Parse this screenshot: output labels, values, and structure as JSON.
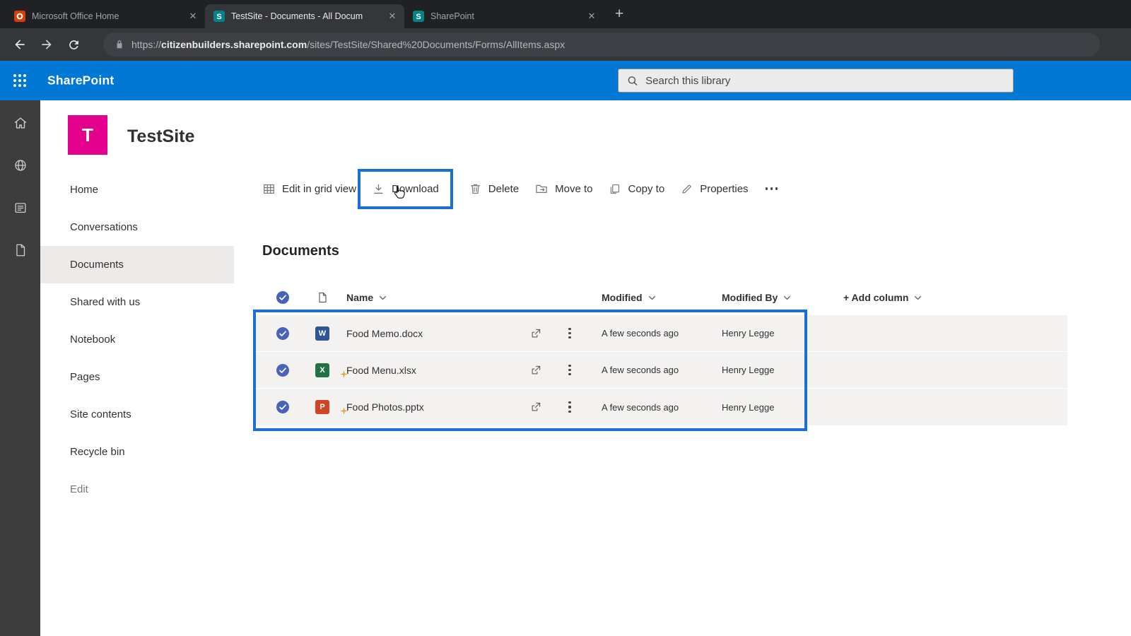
{
  "browser": {
    "tabs": [
      {
        "title": "Microsoft Office Home"
      },
      {
        "title": "TestSite - Documents - All Docum"
      },
      {
        "title": "SharePoint"
      }
    ],
    "close_glyph": "✕",
    "new_tab_glyph": "+",
    "url": {
      "scheme": "https://",
      "domain": "citizenbuilders.sharepoint.com",
      "path": "/sites/TestSite/Shared%20Documents/Forms/AllItems.aspx"
    }
  },
  "suite_bar": {
    "brand": "SharePoint",
    "search_placeholder": "Search this library"
  },
  "site": {
    "logo_letter": "T",
    "name": "TestSite"
  },
  "app_rail": {
    "icons": [
      "home-icon",
      "globe-icon",
      "news-icon",
      "document-icon"
    ]
  },
  "sidebar": {
    "items": [
      {
        "label": "Home"
      },
      {
        "label": "Conversations"
      },
      {
        "label": "Documents",
        "selected": true
      },
      {
        "label": "Shared with us"
      },
      {
        "label": "Notebook"
      },
      {
        "label": "Pages"
      },
      {
        "label": "Site contents"
      },
      {
        "label": "Recycle bin"
      },
      {
        "label": "Edit",
        "muted": true
      }
    ]
  },
  "command_bar": {
    "items": [
      {
        "label": "Edit in grid view",
        "icon": "grid-view-icon"
      },
      {
        "label": "Download",
        "icon": "download-icon",
        "highlighted": true
      },
      {
        "label": "Delete",
        "icon": "trash-icon"
      },
      {
        "label": "Move to",
        "icon": "move-to-icon"
      },
      {
        "label": "Copy to",
        "icon": "copy-to-icon"
      },
      {
        "label": "Properties",
        "icon": "pencil-icon"
      }
    ],
    "overflow_icon": "more-options-icon"
  },
  "library": {
    "title": "Documents",
    "columns": {
      "name": "Name",
      "modified": "Modified",
      "modified_by": "Modified By",
      "add_column": "+ Add column"
    },
    "rows": [
      {
        "name": "Food Memo.docx",
        "file_type": "word",
        "badge": "W",
        "modified": "A few seconds ago",
        "modified_by": "Henry Legge",
        "selected": true,
        "new": false
      },
      {
        "name": "Food Menu.xlsx",
        "file_type": "excel",
        "badge": "X",
        "modified": "A few seconds ago",
        "modified_by": "Henry Legge",
        "selected": true,
        "new": true
      },
      {
        "name": "Food Photos.pptx",
        "file_type": "powerpoint",
        "badge": "P",
        "modified": "A few seconds ago",
        "modified_by": "Henry Legge",
        "selected": true,
        "new": true
      }
    ]
  },
  "colors": {
    "suite_bar": "#0078d4",
    "annotation_box": "#1b6ed4",
    "site_logo": "#e3008c",
    "selected_row_bg": "#f3f2f1",
    "check_circle": "#4a63b8",
    "word": "#2b579a",
    "excel": "#217346",
    "powerpoint": "#d04423"
  }
}
